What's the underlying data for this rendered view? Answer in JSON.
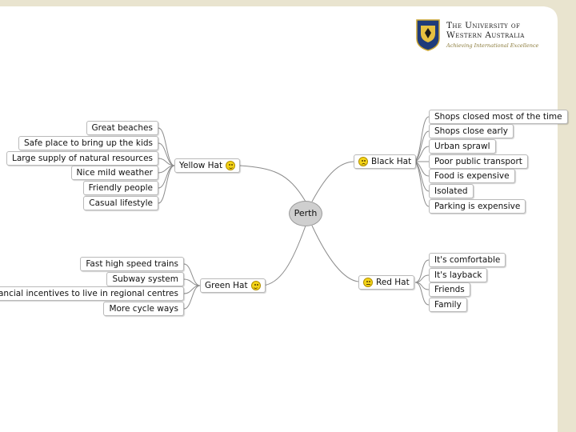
{
  "colors": {
    "background_frame": "#e9e4cf",
    "slide": "#ffffff",
    "connector": "#8c8c8c",
    "root_fill": "#cfcfcf",
    "smiley": "#f4d417"
  },
  "logo": {
    "line1": "The University of",
    "line2": "Western Australia",
    "tagline": "Achieving International Excellence",
    "icon": "university-crest-icon"
  },
  "root": {
    "label": "Perth"
  },
  "hats": {
    "yellow": {
      "label": "Yellow Hat",
      "icon": "smiley-happy-icon",
      "items": [
        "Great beaches",
        "Safe place to bring up the kids",
        "Large supply of natural resources",
        "Nice mild weather",
        "Friendly people",
        "Casual lifestyle"
      ]
    },
    "green": {
      "label": "Green Hat",
      "icon": "smiley-happy-icon",
      "items": [
        "Fast high speed trains",
        "Subway system",
        "Financial incentives to live in regional centres",
        "More cycle ways"
      ]
    },
    "black": {
      "label": "Black Hat",
      "icon": "smiley-sad-icon",
      "items": [
        "Shops closed most of the time",
        "Shops close early",
        "Urban sprawl",
        "Poor public transport",
        "Food is expensive",
        "Isolated",
        "Parking is expensive"
      ]
    },
    "red": {
      "label": "Red Hat",
      "icon": "smiley-neutral-icon",
      "items": [
        "It's comfortable",
        "It's layback",
        "Friends",
        "Family"
      ]
    }
  }
}
